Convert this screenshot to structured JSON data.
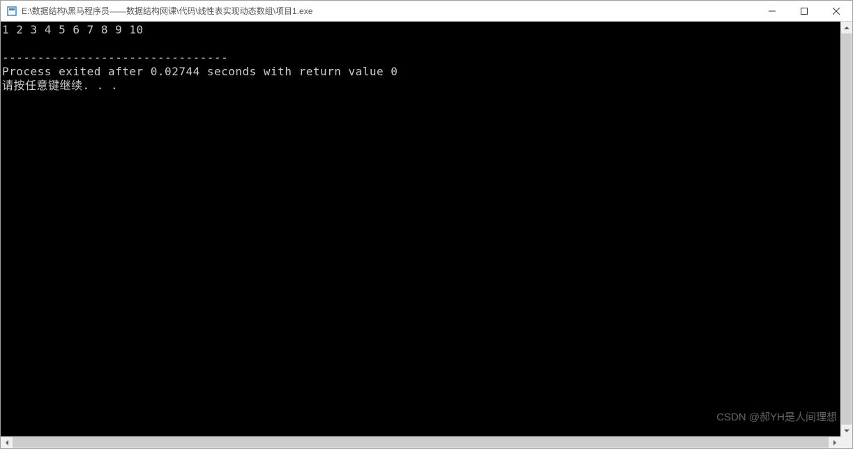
{
  "window": {
    "title": "E:\\数据结构\\黑马程序员——数据结构网课\\代码\\线性表实现动态数组\\项目1.exe"
  },
  "console": {
    "line1": "1 2 3 4 5 6 7 8 9 10",
    "line2": "",
    "line3": "--------------------------------",
    "line4": "Process exited after 0.02744 seconds with return value 0",
    "line5": "请按任意键继续. . ."
  },
  "watermark": "CSDN @郝YH是人间理想"
}
